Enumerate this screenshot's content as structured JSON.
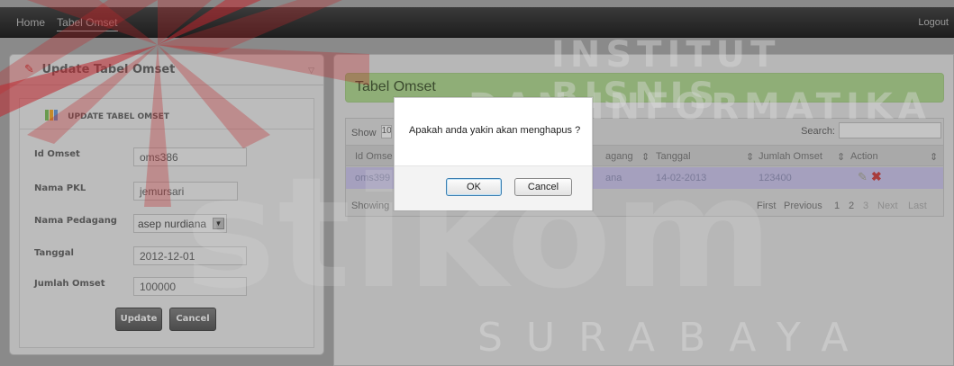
{
  "topbar": {
    "nav": [
      "Home",
      "Tabel Omset"
    ],
    "logout": "Logout"
  },
  "left": {
    "panel_title": "Update Tabel Omset",
    "section_title": "UPDATE TABEL OMSET",
    "fields": [
      {
        "label": "Id Omset",
        "value": "oms386"
      },
      {
        "label": "Nama PKL",
        "value": "jemursari"
      },
      {
        "label": "Nama Pedagang",
        "value": "asep nurdiana"
      },
      {
        "label": "Tanggal",
        "value": "2012-12-01"
      },
      {
        "label": "Jumlah Omset",
        "value": "100000"
      }
    ],
    "update_label": "Update",
    "cancel_label": "Cancel"
  },
  "right": {
    "title": "Tabel Omset",
    "show_label": "Show",
    "show_value": "10",
    "search_label": "Search:",
    "columns": [
      "Id Omset",
      "Nama Pedagang",
      "Tanggal",
      "Jumlah Omset",
      "Action"
    ],
    "columns_visible": {
      "id": "Id Omse",
      "pedagang": "agang"
    },
    "row": {
      "id": "oms399",
      "pedagang": "ana",
      "tanggal": "14-02-2013",
      "jumlah": "123400"
    },
    "showing": "Showing",
    "pager": [
      "First",
      "Previous",
      "1",
      "2",
      "3",
      "Next",
      "Last"
    ]
  },
  "dialog": {
    "message": "Apakah anda yakin akan menghapus ?",
    "ok_label": "OK",
    "cancel_label": "Cancel"
  },
  "watermark": {
    "line1": "INSTITUT BISNIS",
    "line2": "DAN INFORMATIKA",
    "big": "stikom",
    "city": "SURABAYA"
  },
  "colors": {
    "logo_red": "#c0272d",
    "title_green": "#8fae77",
    "selected_row": "#a5a0be"
  }
}
